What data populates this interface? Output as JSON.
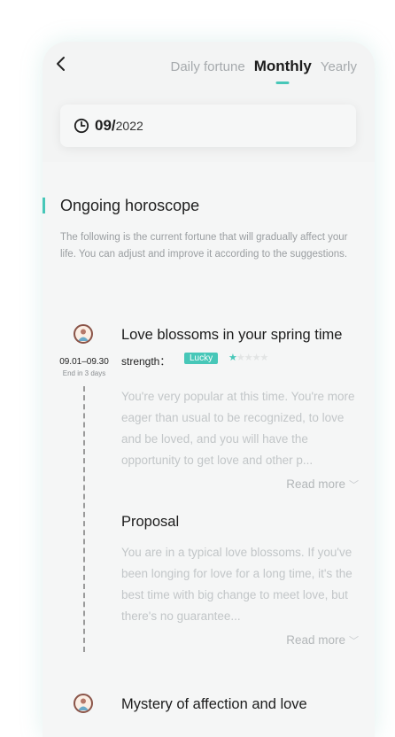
{
  "header": {
    "tabs": [
      "Daily fortune",
      "Monthly",
      "Yearly"
    ],
    "active_tab": "Monthly",
    "date_month": "09/",
    "date_year": "2022"
  },
  "section": {
    "title": "Ongoing horoscope",
    "description": "The following is the current fortune that will gradually affect your life. You can adjust and improve it according to the suggestions."
  },
  "entries": [
    {
      "range": "09.01–09.30",
      "ends": "End in 3 days",
      "title": "Love blossoms in your spring time",
      "strength_label": "strength：",
      "badge": "Lucky",
      "stars_filled": 1,
      "stars_total": 5,
      "text": "You're very popular at this time. You're more eager than usual to be recognized, to love and be loved, and you will have the opportunity to get love and other p...",
      "read_more": "Read more",
      "sub_title": "Proposal",
      "sub_text": "You are in a typical love blossoms. If you've been longing for love for a long time, it's the best time with big change to meet love, but there's no guarantee...",
      "sub_read_more": "Read more"
    },
    {
      "title": "Mystery of affection and love"
    }
  ],
  "colors": {
    "accent": "#47c7b8",
    "avatar_border": "#8a5448"
  },
  "icons": {
    "back": "chevron-left-icon",
    "clock": "clock-icon",
    "avatar": "avatar-icon",
    "read_more": "chevron-down-icon"
  }
}
